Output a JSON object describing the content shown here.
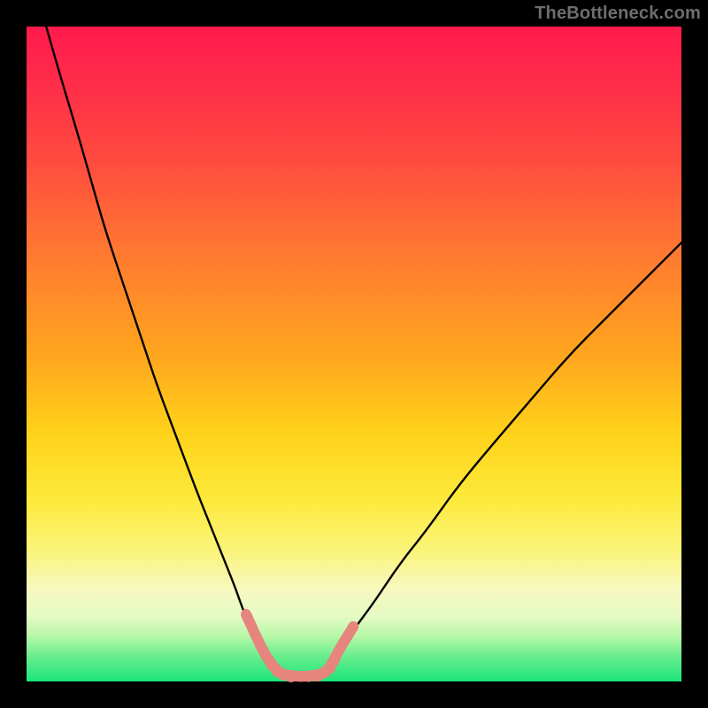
{
  "watermark": "TheBottleneck.com",
  "colors": {
    "frame": "#000000",
    "curve": "#000000",
    "markers": "#e6857e",
    "gradient_top": "#ff1a4d",
    "gradient_bottom": "#1ae57b"
  },
  "chart_data": {
    "type": "line",
    "title": "",
    "xlabel": "",
    "ylabel": "",
    "xlim": [
      0,
      100
    ],
    "ylim": [
      0,
      100
    ],
    "grid": false,
    "legend": false,
    "note": "No axis ticks or numeric labels are rendered; x/y treated as 0–100 percent of plot area, y=0 at bottom. Curve values estimated from pixels.",
    "series": [
      {
        "name": "left-branch",
        "x": [
          3,
          5,
          8,
          10,
          12,
          15,
          18,
          20,
          23,
          26,
          28,
          30,
          32,
          33,
          34.5,
          36,
          37,
          38,
          39
        ],
        "y": [
          100,
          93,
          83,
          76,
          69,
          60,
          51,
          45,
          37,
          29,
          24,
          19,
          14,
          11,
          8,
          5,
          3.5,
          2,
          1.2
        ]
      },
      {
        "name": "valley-floor",
        "x": [
          39,
          40,
          41,
          42,
          43,
          44,
          45
        ],
        "y": [
          1.2,
          0.9,
          0.8,
          0.8,
          0.8,
          0.9,
          1.1
        ]
      },
      {
        "name": "right-branch",
        "x": [
          45,
          46,
          47,
          48,
          50,
          53,
          57,
          61,
          66,
          71,
          77,
          83,
          89,
          95,
          100
        ],
        "y": [
          1.1,
          2,
          3.5,
          5,
          8,
          12,
          18,
          23,
          30,
          36,
          43,
          50,
          56,
          62,
          67
        ]
      }
    ],
    "markers": {
      "name": "highlighted-segments",
      "note": "Pink rounded dashes near the valley on both branches and along the floor.",
      "points": [
        {
          "x": 34.0,
          "y": 9.2
        },
        {
          "x": 35.2,
          "y": 6.6
        },
        {
          "x": 36.2,
          "y": 4.6
        },
        {
          "x": 37.2,
          "y": 3.0
        },
        {
          "x": 38.2,
          "y": 1.8
        },
        {
          "x": 39.3,
          "y": 1.1
        },
        {
          "x": 40.5,
          "y": 0.9
        },
        {
          "x": 41.8,
          "y": 0.8
        },
        {
          "x": 43.0,
          "y": 0.85
        },
        {
          "x": 44.2,
          "y": 1.0
        },
        {
          "x": 45.4,
          "y": 1.4
        },
        {
          "x": 46.4,
          "y": 2.4
        },
        {
          "x": 47.3,
          "y": 4.0
        },
        {
          "x": 48.2,
          "y": 5.6
        },
        {
          "x": 49.3,
          "y": 7.4
        }
      ]
    }
  }
}
